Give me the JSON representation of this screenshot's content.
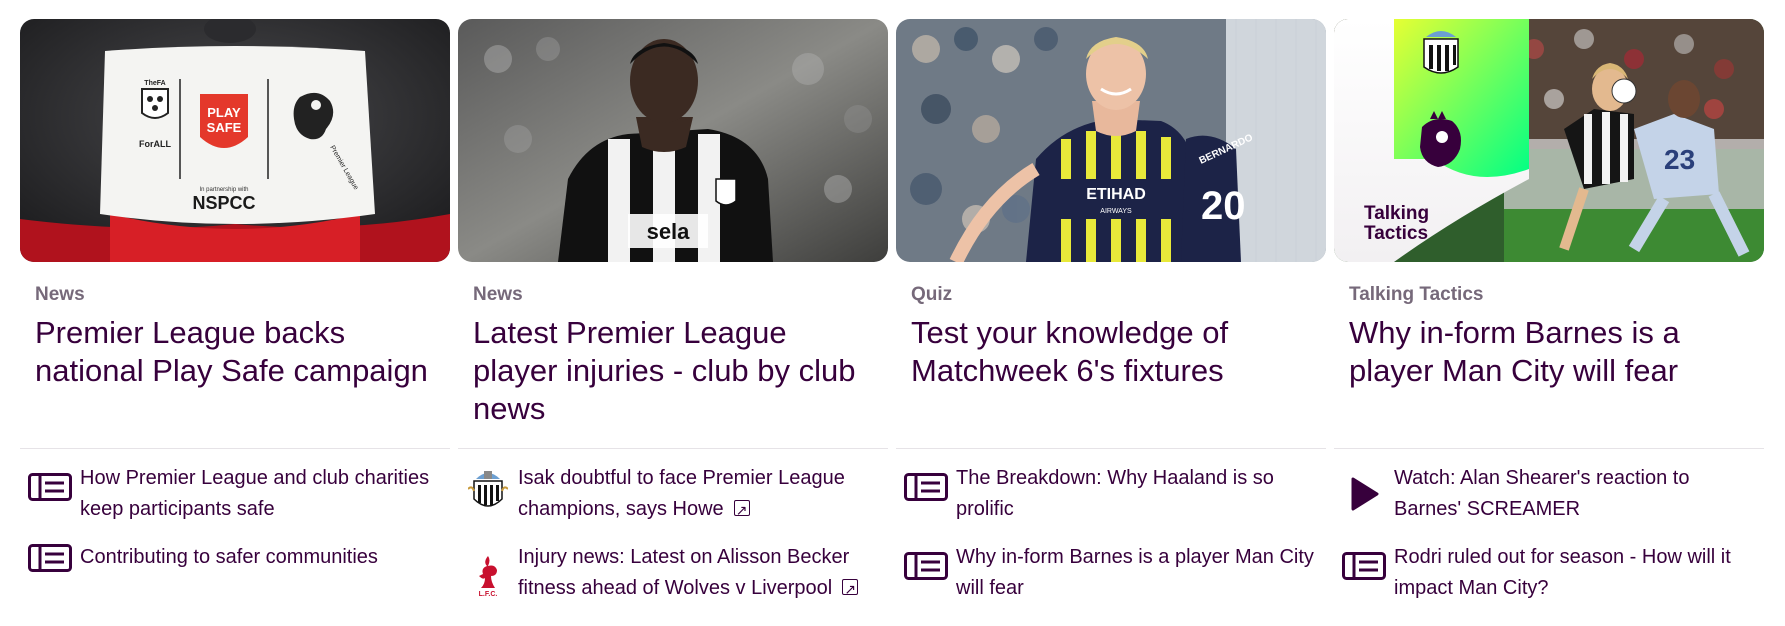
{
  "cards": [
    {
      "category": "News",
      "headline": "Premier League backs national Play Safe campaign",
      "image": {
        "play_line1": "PLAY",
        "play_line2": "SAFE",
        "partner_text": "In partnership with",
        "partner_name": "NSPCC",
        "fa_small": "TheFA",
        "fa_for_all": "ForALL",
        "pl_text": "Premier League"
      },
      "related": [
        {
          "icon": "article-icon",
          "text": "How Premier League and club charities keep participants safe",
          "external": false
        },
        {
          "icon": "article-icon",
          "text": "Contributing to safer communities",
          "external": false
        }
      ]
    },
    {
      "category": "News",
      "headline": "Latest Premier League player injuries - club by club news",
      "image": {
        "sponsor": "sela"
      },
      "related": [
        {
          "icon": "newcastle-crest-icon",
          "text": "Isak doubtful to face Premier League champions, says Howe",
          "external": true
        },
        {
          "icon": "liverpool-crest-icon",
          "text": "Injury news: Latest on Alisson Becker fitness ahead of Wolves v Liverpool",
          "external": true
        }
      ]
    },
    {
      "category": "Quiz",
      "headline": "Test your knowledge of Matchweek 6's fixtures",
      "image": {
        "sponsor": "ETIHAD",
        "sponsor_sub": "AIRWAYS",
        "shirt_name": "BERNARDO",
        "shirt_number": "20"
      },
      "related": [
        {
          "icon": "article-icon",
          "text": "The Breakdown: Why Haaland is so prolific",
          "external": false
        },
        {
          "icon": "article-icon",
          "text": "Why in-form Barnes is a player Man City will fear",
          "external": false
        }
      ]
    },
    {
      "category": "Talking Tactics",
      "headline": "Why in-form Barnes is a player Man City will fear",
      "image": {
        "badge_line1": "Talking",
        "badge_line2": "Tactics",
        "shirt_number": "23"
      },
      "related": [
        {
          "icon": "play-icon",
          "text": "Watch: Alan Shearer's reaction to Barnes' SCREAMER",
          "external": false
        },
        {
          "icon": "article-icon",
          "text": "Rodri ruled out for season - How will it impact Man City?",
          "external": false
        }
      ]
    }
  ],
  "colors": {
    "primary": "#37003c",
    "category": "#76697a",
    "divider": "#e6e3e7",
    "liverpool_red": "#c8102e",
    "green_accent": "#00ff85"
  }
}
